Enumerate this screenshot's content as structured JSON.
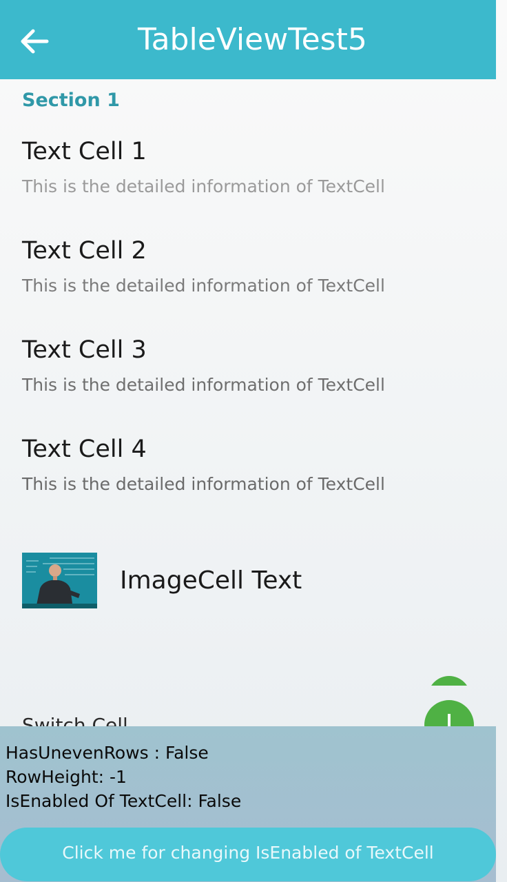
{
  "app": {
    "title": "TableViewTest5"
  },
  "icons": {
    "back": "arrow-left-icon",
    "add": "plus-icon"
  },
  "colors": {
    "header": "#3cb9cc",
    "section": "#3098a8",
    "fab": "#4fb144",
    "button": "#4fc8d9"
  },
  "section": {
    "label": "Section 1"
  },
  "text_cells": [
    {
      "title": "Text Cell 1",
      "detail": "This is the detailed information of TextCell"
    },
    {
      "title": "Text Cell 2",
      "detail": "This is the detailed information of TextCell"
    },
    {
      "title": "Text Cell 3",
      "detail": "This is the detailed information of TextCell"
    },
    {
      "title": "Text Cell 4",
      "detail": "This is the detailed information of TextCell"
    }
  ],
  "image_cell": {
    "text": "ImageCell Text"
  },
  "switch_cell": {
    "label": "Switch Cell"
  },
  "info": {
    "has_uneven_rows": "HasUnevenRows : False",
    "row_height": "RowHeight: -1",
    "is_enabled": "IsEnabled Of TextCell: False"
  },
  "action_button": {
    "label": "Click me for changing IsEnabled of TextCell"
  }
}
